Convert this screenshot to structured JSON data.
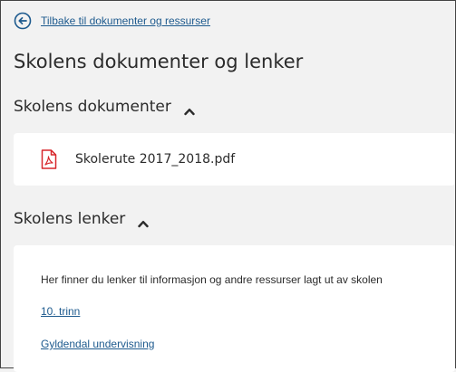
{
  "back_link": {
    "label": "Tilbake til dokumenter og ressurser",
    "icon": "arrow-left-circle-icon"
  },
  "page_title": "Skolens dokumenter og lenker",
  "documents_section": {
    "title": "Skolens dokumenter",
    "expanded": true,
    "items": [
      {
        "name": "Skolerute 2017_2018.pdf",
        "icon": "pdf-file-icon"
      }
    ]
  },
  "links_section": {
    "title": "Skolens lenker",
    "expanded": true,
    "description": "Her finner du lenker til informasjon og andre ressurser lagt ut av skolen",
    "links": [
      {
        "label": "10. trinn"
      },
      {
        "label": "Gyldendal undervisning"
      }
    ]
  },
  "colors": {
    "background": "#f2f2f2",
    "card": "#ffffff",
    "link": "#1d5a8e",
    "text": "#2b2b2b",
    "pdf_red": "#d7262b"
  }
}
